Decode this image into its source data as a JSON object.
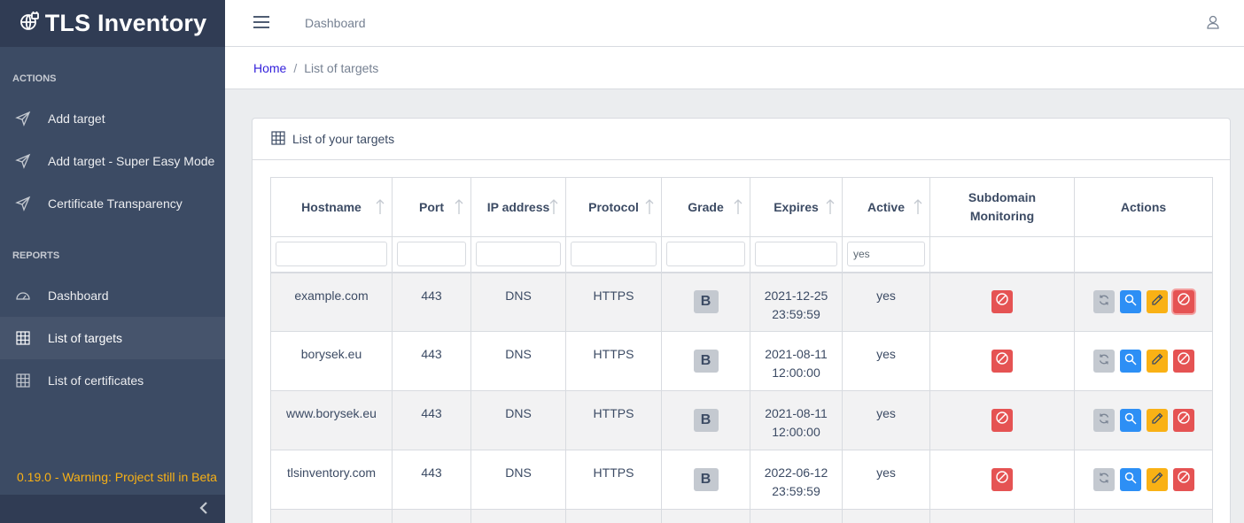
{
  "app": {
    "title": "TLS Inventory"
  },
  "sidebar": {
    "sections": [
      {
        "label": "ACTIONS"
      },
      {
        "label": "REPORTS"
      }
    ],
    "items": [
      {
        "label": "Add target",
        "icon": "send-icon"
      },
      {
        "label": "Add target - Super Easy Mode",
        "icon": "send-icon"
      },
      {
        "label": "Certificate Transparency",
        "icon": "send-icon"
      },
      {
        "label": "Dashboard",
        "icon": "speedometer-icon"
      },
      {
        "label": "List of targets",
        "icon": "grid-icon",
        "active": true
      },
      {
        "label": "List of certificates",
        "icon": "grid-icon"
      }
    ],
    "version_text": "0.19.0 - Warning: Project still in Beta"
  },
  "header": {
    "nav_link": "Dashboard"
  },
  "breadcrumb": {
    "home": "Home",
    "current": "List of targets"
  },
  "card": {
    "title": "List of your targets"
  },
  "table": {
    "columns": [
      "Hostname",
      "Port",
      "IP address",
      "Protocol",
      "Grade",
      "Expires",
      "Active",
      "Subdomain Monitoring",
      "Actions"
    ],
    "filters": {
      "active": "yes"
    },
    "rows": [
      {
        "hostname": "example.com",
        "port": "443",
        "ip": "DNS",
        "protocol": "HTTPS",
        "grade": "B",
        "expires_date": "2021-12-25",
        "expires_time": "23:59:59",
        "active": "yes"
      },
      {
        "hostname": "borysek.eu",
        "port": "443",
        "ip": "DNS",
        "protocol": "HTTPS",
        "grade": "B",
        "expires_date": "2021-08-11",
        "expires_time": "12:00:00",
        "active": "yes"
      },
      {
        "hostname": "www.borysek.eu",
        "port": "443",
        "ip": "DNS",
        "protocol": "HTTPS",
        "grade": "B",
        "expires_date": "2021-08-11",
        "expires_time": "12:00:00",
        "active": "yes"
      },
      {
        "hostname": "tlsinventory.com",
        "port": "443",
        "ip": "DNS",
        "protocol": "HTTPS",
        "grade": "B",
        "expires_date": "2022-06-12",
        "expires_time": "23:59:59",
        "active": "yes"
      }
    ]
  },
  "colors": {
    "sidebar": "#3c4b64",
    "primary": "#321fdb",
    "warning": "#f9b115",
    "danger": "#e55353",
    "info": "#2d8ff5"
  }
}
